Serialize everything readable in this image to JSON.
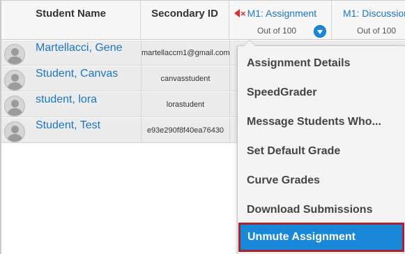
{
  "header": {
    "student_name": "Student Name",
    "secondary_id": "Secondary ID",
    "assignment": {
      "name": "M1: Assignment",
      "subtitle": "Out of 100",
      "muted_icon": "speaker-muted-icon",
      "muted_color": "#d9302f"
    },
    "discussion": {
      "name": "M1: Discussion",
      "subtitle": "Out of 100"
    }
  },
  "students": [
    {
      "name": "Martellacci, Gene",
      "secondary_id": "martellaccm1@gmail.com"
    },
    {
      "name": "Student, Canvas",
      "secondary_id": "canvasstudent"
    },
    {
      "name": "student, lora",
      "secondary_id": "lorastudent"
    },
    {
      "name": "Student, Test",
      "secondary_id": "e93e290f8f40ea76430"
    }
  ],
  "menu": {
    "items": [
      "Assignment Details",
      "SpeedGrader",
      "Message Students Who...",
      "Set Default Grade",
      "Curve Grades",
      "Download Submissions",
      "Unmute Assignment"
    ],
    "active_index": 6,
    "accent_color": "#1a88d8",
    "highlight_border_color": "#a8232d"
  }
}
